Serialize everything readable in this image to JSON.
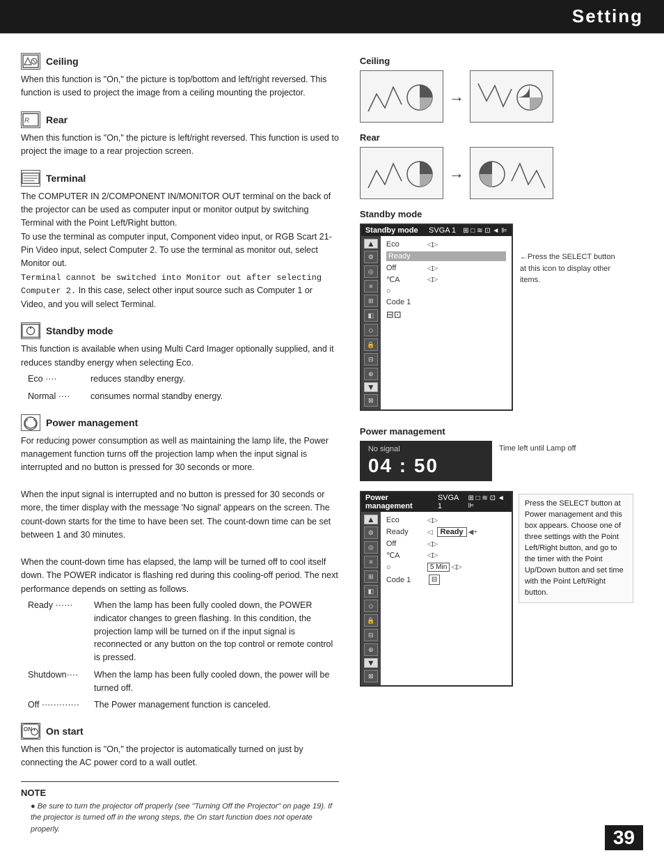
{
  "header": {
    "title": "Setting"
  },
  "page_number": "39",
  "left_col": {
    "sections": [
      {
        "id": "ceiling",
        "icon": "ceiling-icon",
        "title": "Ceiling",
        "body": "When this function is \"On,\" the picture is top/bottom and left/right reversed.  This function is used to project the image from a ceiling mounting the  projector."
      },
      {
        "id": "rear",
        "icon": "rear-icon",
        "title": "Rear",
        "body": "When this function is \"On,\" the picture is left/right reversed.  This function is used to project the image to a rear projection screen."
      },
      {
        "id": "terminal",
        "icon": "terminal-icon",
        "title": "Terminal",
        "body": "The COMPUTER IN 2/COMPONENT IN/MONITOR OUT terminal on the back of the projector can be used as computer input or monitor output by switching Terminal with the Point Left/Right button.\nTo use the terminal as computer input, Component video input, or RGB Scart 21-Pin Video input, select Computer 2.  To use the terminal as monitor out, select Monitor out.\nTerminal cannot be switched into Monitor out after selecting Computer 2.  In this case, select other input source such as Computer 1 or Video, and you will select Terminal."
      },
      {
        "id": "standby_mode",
        "icon": "standby-mode-icon",
        "title": "Standby mode",
        "body": "This function is available when using Multi Card Imager optionally supplied, and it reduces standby energy when selecting Eco.",
        "list": [
          {
            "term": "Eco    ····",
            "def": "reduces standby energy."
          },
          {
            "term": "Normal ····",
            "def": "consumes normal standby energy."
          }
        ]
      },
      {
        "id": "power_management",
        "icon": "power-mgmt-icon",
        "title": "Power management",
        "body": "For reducing power consumption as well as maintaining the lamp life, the Power management function turns off the projection lamp when the input signal is interrupted and no button is pressed for 30 seconds or more.\n\nWhen the input signal is interrupted and no button is pressed for 30 seconds or more, the timer display with the message 'No signal' appears on the screen. The count-down starts for the time to have been set.  The count-down time can be set between 1 and 30 minutes.\n\nWhen the count-down time has elapsed, the lamp will be turned off to cool itself down.  The POWER indicator is flashing red during this cooling-off period.  The next performance depends on setting as follows.",
        "ready_list": [
          {
            "term": "Ready ······",
            "def": "When the lamp has been fully cooled down, the POWER indicator changes to green flashing. In this condition, the projection lamp will be turned on if the input signal is reconnected or any button on the top control or remote control is pressed."
          },
          {
            "term": "Shutdown····",
            "def": "When the lamp has been fully cooled down, the power will be turned off."
          },
          {
            "term": "Off ·············",
            "def": "The Power management function is canceled."
          }
        ]
      },
      {
        "id": "on_start",
        "icon": "on-start-icon",
        "title": "On start",
        "body": "When this function is \"On,\" the projector is automatically turned on just by connecting the AC power cord to a wall outlet."
      }
    ],
    "note": {
      "title": "NOTE",
      "bullets": [
        "Be sure to turn the projector off properly (see \"Turning Off the  Projector\" on page 19).  If the projector is turned off in the wrong steps, the On start function does not operate properly."
      ]
    }
  },
  "right_col": {
    "ceiling_label": "Ceiling",
    "rear_label": "Rear",
    "standby_mode_label": "Standby mode",
    "standby_panel": {
      "header_title": "Standby mode",
      "svga": "SVGA 1",
      "rows": [
        {
          "label": "Eco",
          "value": "",
          "has_arrows": true
        },
        {
          "label": "Ready",
          "value": "",
          "has_arrows": false
        },
        {
          "label": "Off",
          "value": "",
          "has_arrows": true
        },
        {
          "label": "♀A",
          "value": "",
          "has_arrows": true
        },
        {
          "label": "○",
          "value": "",
          "has_arrows": false
        },
        {
          "label": "Code 1",
          "value": "",
          "has_arrows": false
        }
      ],
      "note": "Press the SELECT button at this icon to display other items."
    },
    "power_management_label": "Power management",
    "no_signal_text": "No signal",
    "timer_text": "04 : 50",
    "time_left_note": "Time  left  until  Lamp off",
    "pm_panel": {
      "header_title": "Power management",
      "svga": "SVGA 1",
      "rows": [
        {
          "label": "Eco",
          "value": "",
          "has_arrows": true
        },
        {
          "label": "Ready",
          "value": "",
          "has_arrows": true
        },
        {
          "label": "Off",
          "value": "",
          "has_arrows": true
        },
        {
          "label": "♀A",
          "value": "",
          "has_arrows": true
        },
        {
          "label": "○",
          "value": "",
          "has_arrows": false
        },
        {
          "label": "Code 1",
          "value": "",
          "has_arrows": false
        }
      ],
      "ready_value": "Ready",
      "minutes_value": "5  Min",
      "pm_note": "Press the SELECT button at Power management and this box appears.  Choose one of three settings with the Point Left/Right button, and go to the timer with the Point Up/Down button and set time with the Point Left/Right button."
    }
  }
}
